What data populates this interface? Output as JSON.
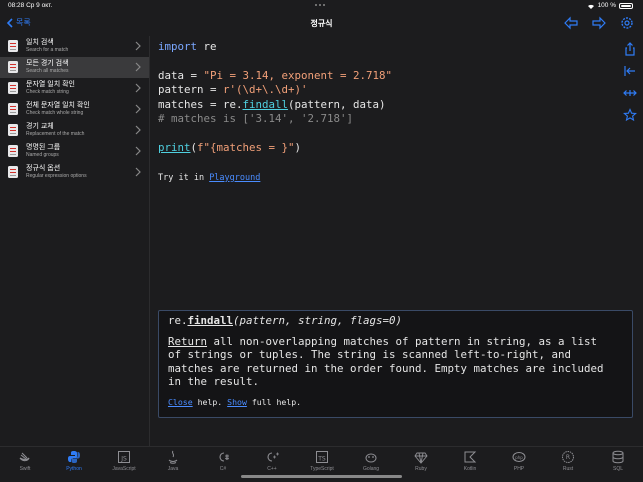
{
  "status": {
    "time_date": "08:28  Ср 9 окт.",
    "battery": "100 %"
  },
  "nav": {
    "back_label": "목록",
    "title": "정규식"
  },
  "sidebar": {
    "items": [
      {
        "title": "일치 검색",
        "subtitle": "Search for a match",
        "active": false
      },
      {
        "title": "모든 경기 검색",
        "subtitle": "Search all matches",
        "active": true
      },
      {
        "title": "문자열 일치 확인",
        "subtitle": "Check match string",
        "active": false
      },
      {
        "title": "전체 문자열 일치 확인",
        "subtitle": "Check match whole string",
        "active": false
      },
      {
        "title": "경기 교체",
        "subtitle": "Replacement of the match",
        "active": false
      },
      {
        "title": "명명된 그룹",
        "subtitle": "Named groups",
        "active": false
      },
      {
        "title": "정규식 옵션",
        "subtitle": "Regular expression options",
        "active": false
      }
    ]
  },
  "code": {
    "l1_kw": "import",
    "l1_rest": " re",
    "l3_a": "data = ",
    "l3_str": "\"Pi = 3.14, exponent = 2.718\"",
    "l4_a": "pattern = ",
    "l4_str": "r'(\\d+\\.\\d+)'",
    "l5_a": "matches = re.",
    "l5_fn": "findall",
    "l5_b": "(pattern, data)",
    "l6_cmt": "# matches is ['3.14', '2.718']",
    "l8_fn": "print",
    "l8_a": "(",
    "l8_str": "f\"{matches = }\"",
    "l8_b": ")",
    "try_text": "Try it in ",
    "try_link": "Playground"
  },
  "help": {
    "sig_pre": "re.",
    "sig_fn": "findall",
    "sig_args": "(pattern, string, flags=0)",
    "body_link": "Return",
    "body_text": " all non-overlapping matches of pattern in string, as a list\nof strings or tuples. The string is scanned left-to-right, and\nmatches are returned in the order found. Empty matches are included\nin the result.",
    "close": "Close",
    "mid": " help. ",
    "show": "Show",
    "end": " full help."
  },
  "tabs": [
    {
      "label": "Swift",
      "icon": "swift-icon",
      "active": false
    },
    {
      "label": "Python",
      "icon": "python-icon",
      "active": true
    },
    {
      "label": "JavaScript",
      "icon": "javascript-icon",
      "active": false
    },
    {
      "label": "Java",
      "icon": "java-icon",
      "active": false
    },
    {
      "label": "C#",
      "icon": "csharp-icon",
      "active": false
    },
    {
      "label": "C++",
      "icon": "cpp-icon",
      "active": false
    },
    {
      "label": "TypeScript",
      "icon": "typescript-icon",
      "active": false
    },
    {
      "label": "Golang",
      "icon": "golang-icon",
      "active": false
    },
    {
      "label": "Ruby",
      "icon": "ruby-icon",
      "active": false
    },
    {
      "label": "Kotlin",
      "icon": "kotlin-icon",
      "active": false
    },
    {
      "label": "PHP",
      "icon": "php-icon",
      "active": false
    },
    {
      "label": "Rust",
      "icon": "rust-icon",
      "active": false
    },
    {
      "label": "SQL",
      "icon": "sql-icon",
      "active": false
    }
  ],
  "colors": {
    "accent": "#2f7cf6",
    "background": "#1c1c1e",
    "active_row": "#3a3a3c"
  }
}
